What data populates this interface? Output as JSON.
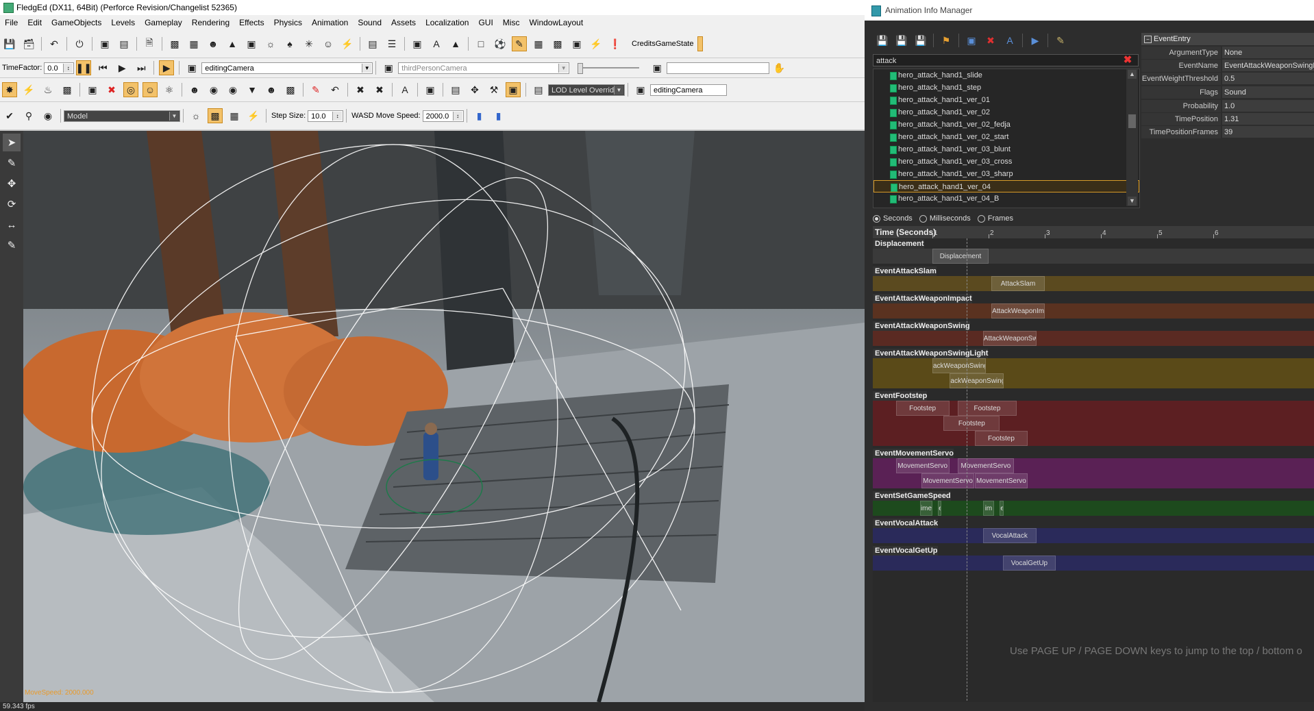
{
  "editor": {
    "title": "FledgEd (DX11, 64Bit) (Perforce Revision/Changelist 52365)",
    "menu": [
      "File",
      "Edit",
      "GameObjects",
      "Levels",
      "Gameplay",
      "Rendering",
      "Effects",
      "Physics",
      "Animation",
      "Sound",
      "Assets",
      "Localization",
      "GUI",
      "Misc",
      "WindowLayout"
    ],
    "toolbar1": {
      "credits_label": "CreditsGameState"
    },
    "toolbar2": {
      "timefactor_label": "TimeFactor:",
      "timefactor_value": "0.0",
      "camera1": "editingCamera",
      "camera2": "thirdPersonCamera"
    },
    "toolbar3": {
      "lod_label": "LOD Level Overrid",
      "camera3": "editingCamera"
    },
    "toolbar4": {
      "model_select": "Model",
      "step_size_label": "Step Size:",
      "step_size_value": "10.0",
      "wasd_label": "WASD Move Speed:",
      "wasd_value": "2000.0"
    },
    "viewport": {
      "move_speed": "MoveSpeed: 2000.000"
    },
    "status": {
      "fps": "59.343 fps"
    }
  },
  "aim": {
    "title": "Animation Info Manager",
    "search": "attack",
    "animations": [
      "hero_attack_hand1_slide",
      "hero_attack_hand1_step",
      "hero_attack_hand1_ver_01",
      "hero_attack_hand1_ver_02",
      "hero_attack_hand1_ver_02_fedja",
      "hero_attack_hand1_ver_02_start",
      "hero_attack_hand1_ver_03_blunt",
      "hero_attack_hand1_ver_03_cross",
      "hero_attack_hand1_ver_03_sharp",
      "hero_attack_hand1_ver_04",
      "hero_attack_hand1_ver_04_B"
    ],
    "selected_index": 9,
    "properties": {
      "header": "EventEntry",
      "rows": [
        {
          "key": "ArgumentType",
          "value": "None"
        },
        {
          "key": "EventName",
          "value": "EventAttackWeaponSwingLi"
        },
        {
          "key": "EventWeightThreshold",
          "value": "0.5"
        },
        {
          "key": "Flags",
          "value": "Sound"
        },
        {
          "key": "Probability",
          "value": "1.0"
        },
        {
          "key": "TimePosition",
          "value": "1.31"
        },
        {
          "key": "TimePositionFrames",
          "value": "39"
        }
      ]
    },
    "units": {
      "seconds": "Seconds",
      "milliseconds": "Milliseconds",
      "frames": "Frames",
      "selected": "seconds"
    },
    "timeline": {
      "header": "Time (Seconds)",
      "ticks": [
        "1",
        "2",
        "3",
        "4",
        "5",
        "6"
      ],
      "tracks": [
        {
          "name": "Displacement",
          "color": "#3a3a3a",
          "rows": [
            [
              {
                "label": "Displacement",
                "start": 1.0,
                "end": 2.0
              }
            ]
          ]
        },
        {
          "name": "EventAttackSlam",
          "color": "#5b4a1f",
          "rows": [
            [
              {
                "label": "AttackSlam",
                "start": 2.05,
                "end": 3.0
              }
            ]
          ]
        },
        {
          "name": "EventAttackWeaponImpact",
          "color": "#5a3220",
          "rows": [
            [
              {
                "label": "AttackWeaponImpac",
                "start": 2.05,
                "end": 3.0
              }
            ]
          ]
        },
        {
          "name": "EventAttackWeaponSwing",
          "color": "#5a2a22",
          "rows": [
            [
              {
                "label": "AttackWeaponSwing",
                "start": 1.9,
                "end": 2.85
              }
            ]
          ]
        },
        {
          "name": "EventAttackWeaponSwingLight",
          "color": "#5a4a18",
          "rows": [
            [
              {
                "label": "ackWeaponSwingLig",
                "start": 1.0,
                "end": 1.95
              }
            ],
            [
              {
                "label": "ackWeaponSwingLic",
                "start": 1.31,
                "end": 2.27
              }
            ]
          ]
        },
        {
          "name": "EventFootstep",
          "color": "#5c1f22",
          "rows": [
            [
              {
                "label": "Footstep",
                "start": 0.35,
                "end": 1.3
              },
              {
                "label": "Footstep",
                "start": 1.45,
                "end": 2.5
              }
            ],
            [
              {
                "label": "Footstep",
                "start": 1.2,
                "end": 2.2
              }
            ],
            [
              {
                "label": "Footstep",
                "start": 1.75,
                "end": 2.7
              }
            ]
          ]
        },
        {
          "name": "EventMovementServo",
          "color": "#5a2155",
          "rows": [
            [
              {
                "label": "MovementServo",
                "start": 0.35,
                "end": 1.3
              },
              {
                "label": "MovementServo",
                "start": 1.45,
                "end": 2.45
              }
            ],
            [
              {
                "label": "MovementServo",
                "start": 0.8,
                "end": 1.75
              },
              {
                "label": "MovementServo",
                "start": 1.75,
                "end": 2.7
              }
            ]
          ]
        },
        {
          "name": "EventSetGameSpeed",
          "color": "#1d4a1d",
          "rows": [
            [
              {
                "label": "imeS",
                "start": 0.78,
                "end": 1.0
              },
              {
                "label": "e",
                "start": 1.1,
                "end": 1.16
              },
              {
                "label": "im",
                "start": 1.9,
                "end": 2.1
              },
              {
                "label": "e",
                "start": 2.2,
                "end": 2.27
              }
            ]
          ]
        },
        {
          "name": "EventVocalAttack",
          "color": "#2a2a5a",
          "rows": [
            [
              {
                "label": "VocalAttack",
                "start": 1.9,
                "end": 2.85
              }
            ]
          ]
        },
        {
          "name": "EventVocalGetUp",
          "color": "#2a2a5a",
          "rows": [
            [
              {
                "label": "VocalGetUp",
                "start": 2.25,
                "end": 3.2
              }
            ]
          ]
        }
      ]
    },
    "hint": "Use PAGE UP / PAGE DOWN keys to jump to the top / bottom o"
  }
}
